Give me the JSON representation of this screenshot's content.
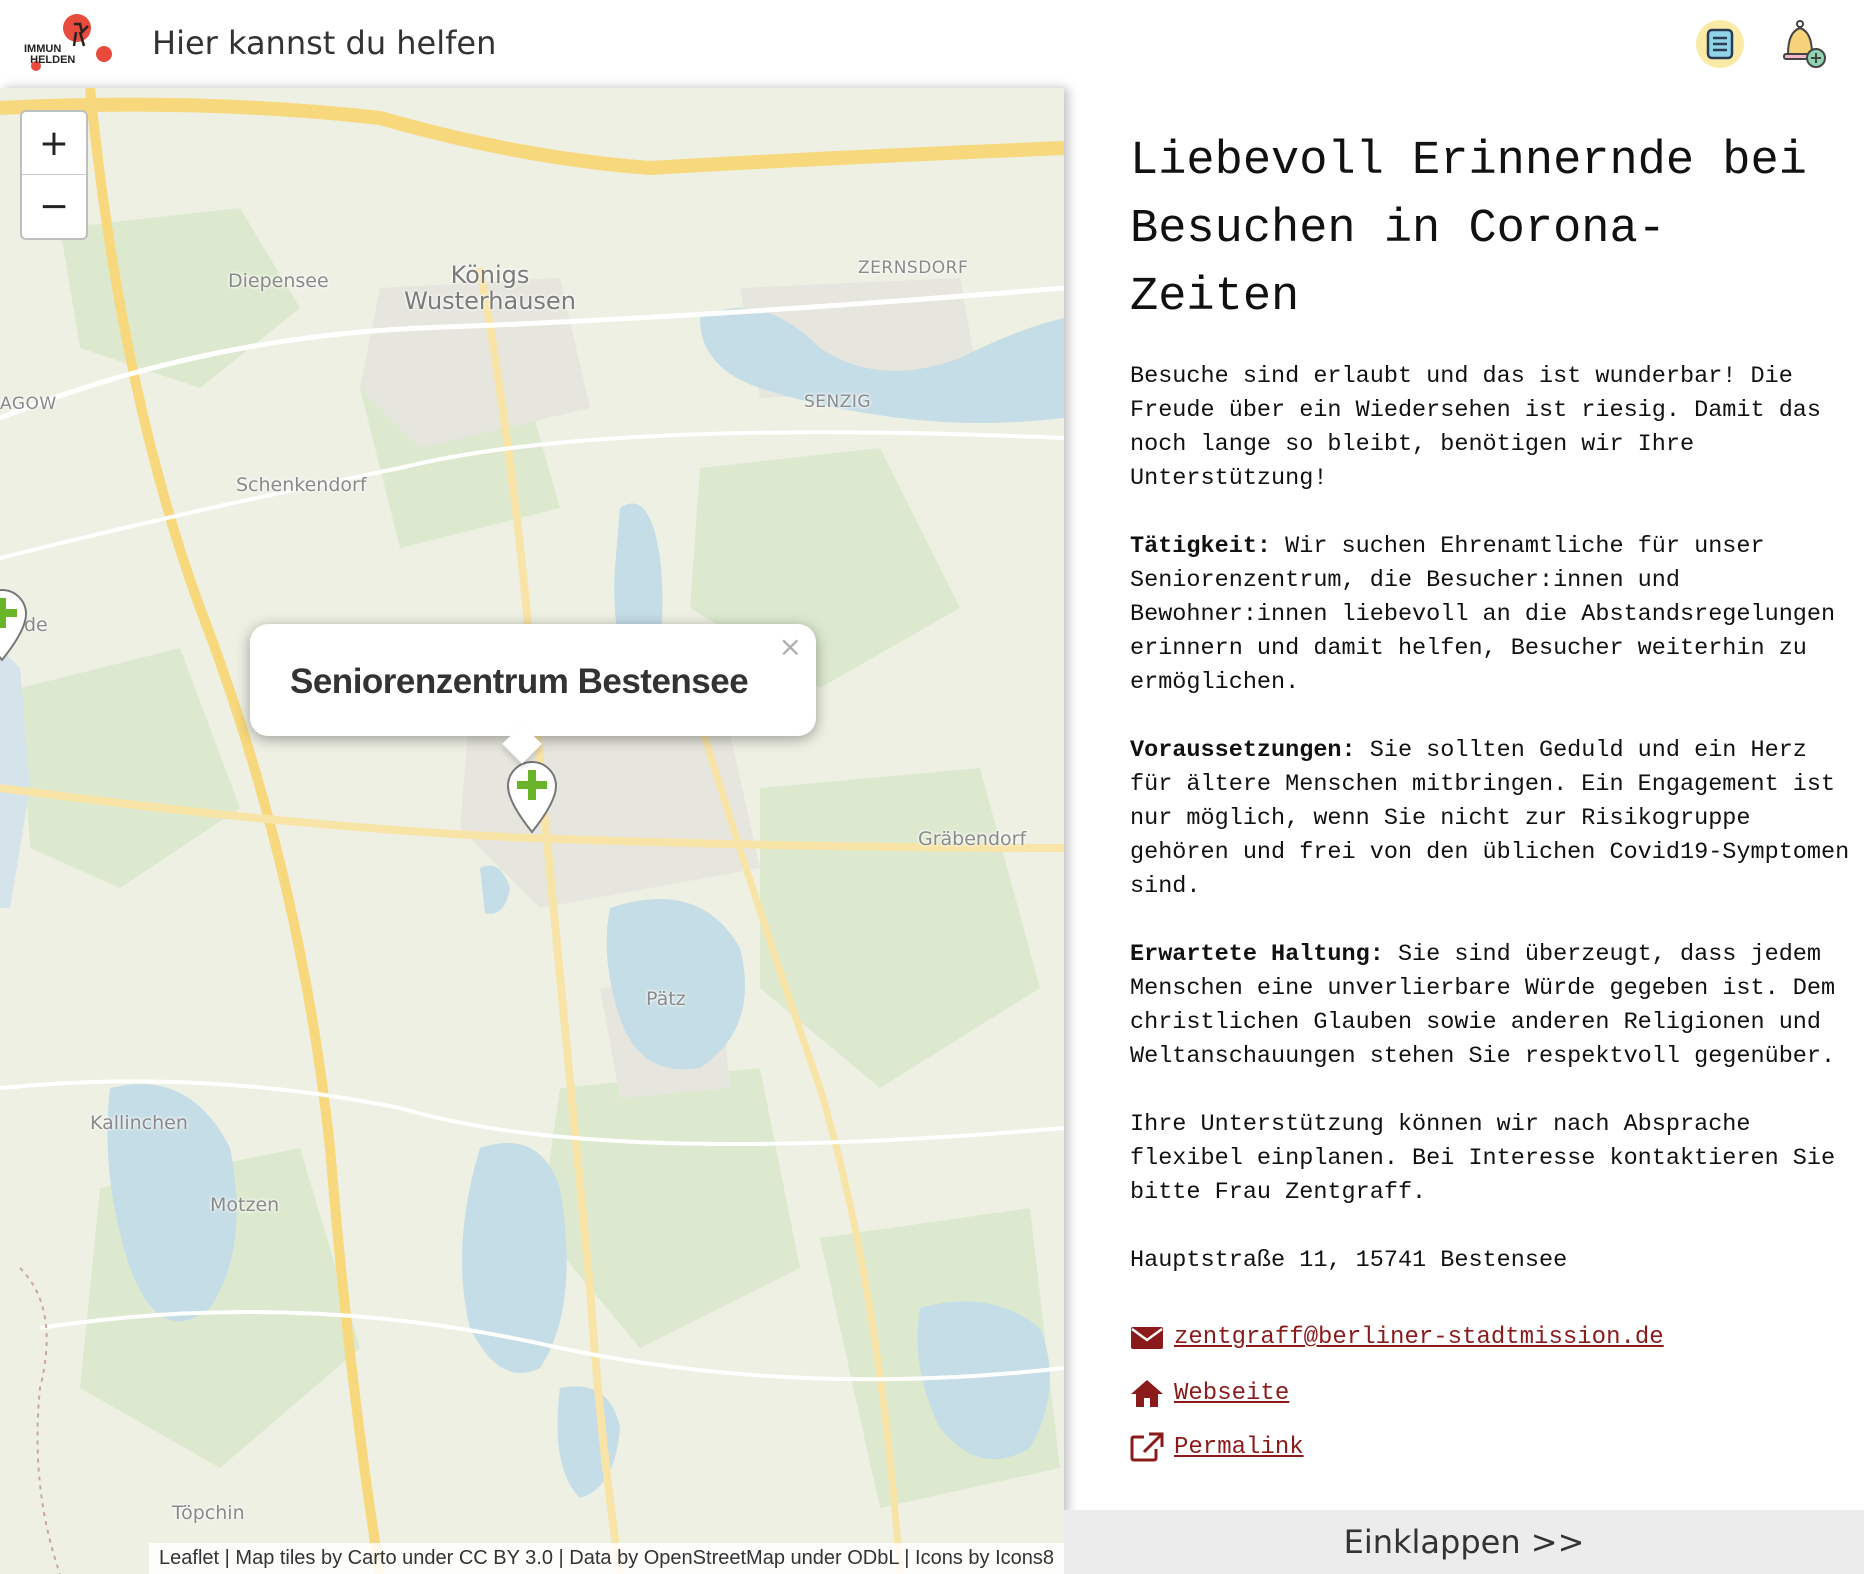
{
  "header": {
    "logo_text_line1": "IMMUN",
    "logo_text_line2": "HELDEN",
    "title": "Hier kannst du helfen",
    "list_icon": "list-icon",
    "bell_icon": "bell-add-icon"
  },
  "map": {
    "zoom_in_label": "+",
    "zoom_out_label": "−",
    "places": {
      "diepensee": "Diepensee",
      "koenigs_wusterhausen_1": "Königs",
      "koenigs_wusterhausen_2": "Wusterhausen",
      "zernsdorf": "ZERNSDORF",
      "senzig": "SENZIG",
      "agow": "AGOW",
      "schenkendorf": "Schenkendorf",
      "de": "de",
      "graebendorf": "Gräbendorf",
      "paetz": "Pätz",
      "kallinchen": "Kallinchen",
      "motzen": "Motzen",
      "toepchin": "Töpchin"
    },
    "popup": {
      "title": "Seniorenzentrum Bestensee",
      "close_label": "×"
    },
    "marker_icon": "plus-marker-icon",
    "attribution": "Leaflet | Map tiles by Carto under CC BY 3.0 | Data by OpenStreetMap under ODbL | Icons by Icons8",
    "colors": {
      "water": "#c5dde6",
      "road": "#f7d87c",
      "land": "#eef0e4",
      "green": "#dde9cf",
      "marker": "#6ab42a"
    }
  },
  "detail": {
    "title": "Liebevoll Erinnernde bei Besuchen in Corona-Zeiten",
    "intro": "Besuche sind erlaubt und das ist wunderbar! Die Freude über ein Wiedersehen ist riesig. Damit das noch lange so bleibt, benötigen wir Ihre Unterstützung!",
    "activity_label": "Tätigkeit:",
    "activity_text": " Wir suchen Ehrenamtliche für unser Seniorenzentrum, die Besucher:innen und Bewohner:innen liebevoll an die Abstandsregelungen erinnern und damit helfen, Besucher weiterhin zu ermöglichen.",
    "requirements_label": "Voraussetzungen:",
    "requirements_text": " Sie sollten Geduld und ein Herz für ältere Menschen mitbringen. Ein Engagement ist nur möglich, wenn Sie nicht zur Risikogruppe gehören und frei von den üblichen Covid19-Symptomen sind.",
    "attitude_label": "Erwartete Haltung:",
    "attitude_text": " Sie sind überzeugt, dass jedem Menschen eine unverlierbare Würde gegeben ist. Dem christlichen Glauben sowie anderen Religionen und Weltanschauungen stehen Sie respektvoll gegenüber.",
    "closing": "Ihre Unterstützung können wir nach Absprache flexibel einplanen. Bei Interesse kontaktieren Sie bitte Frau Zentgraff.",
    "address": "Hauptstraße 11, 15741 Bestensee",
    "email": "zentgraff@berliner-stadtmission.de",
    "website_label": "Webseite",
    "permalink_label": "Permalink",
    "link_color": "#8b1a1a"
  },
  "collapse_label": "Einklappen >>"
}
